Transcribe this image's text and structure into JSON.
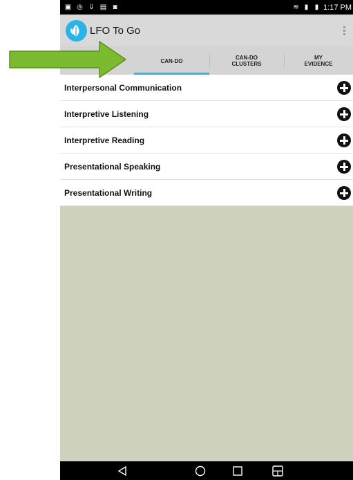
{
  "status_bar": {
    "time": "1:17 PM"
  },
  "app_bar": {
    "title": "LFO To Go"
  },
  "tabs": [
    {
      "label": "CAN-DO",
      "active": true
    },
    {
      "label": "CAN-DO\nCLUSTERS",
      "active": false
    },
    {
      "label": "MY\nEVIDENCE",
      "active": false
    }
  ],
  "categories": [
    {
      "label": "Interpersonal Communication"
    },
    {
      "label": "Interpretive Listening"
    },
    {
      "label": "Interpretive Reading"
    },
    {
      "label": "Presentational Speaking"
    },
    {
      "label": "Presentational Writing"
    }
  ],
  "colors": {
    "accent": "#33b5e5",
    "arrow": "#7cbb2f",
    "background": "#cfd2bc"
  }
}
